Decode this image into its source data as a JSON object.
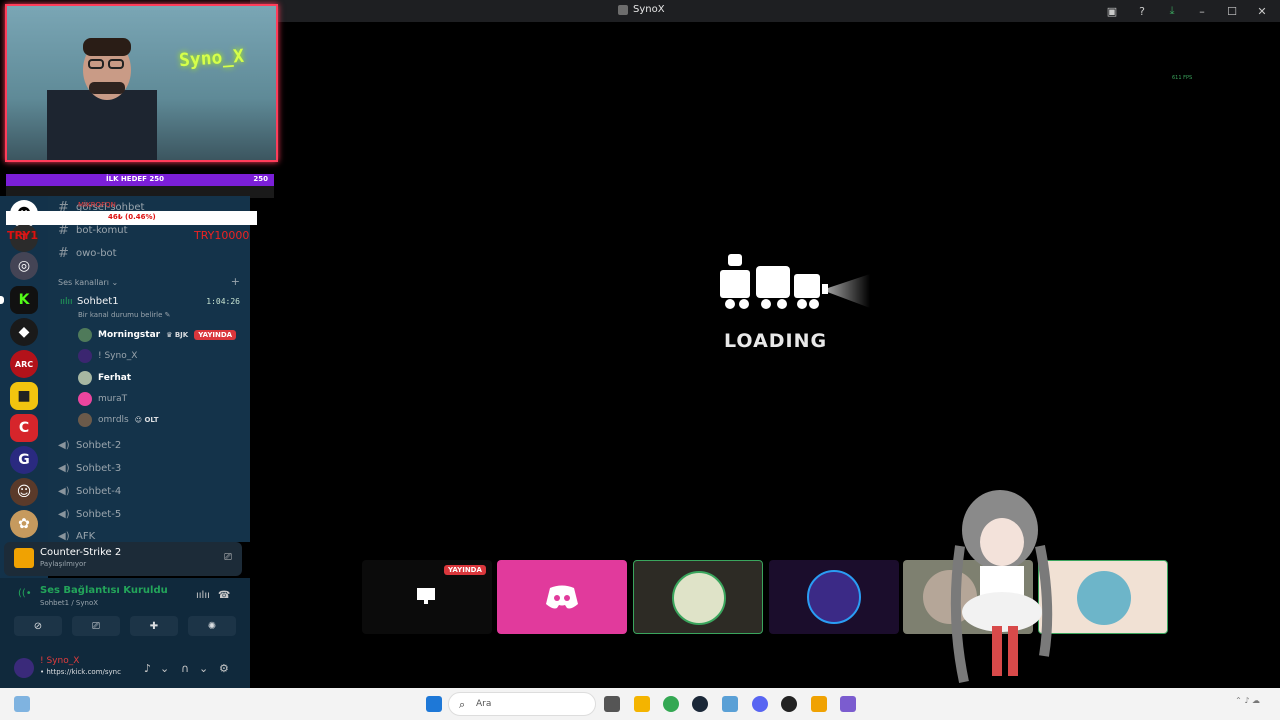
{
  "window": {
    "title": "SynoX"
  },
  "webcam": {
    "neon_text": "Syno_X"
  },
  "goal": {
    "label": "İLK HEDEF 250",
    "value": "250"
  },
  "overlay": {
    "mic_text": "MİKROFON",
    "percent": "46₺ (0.46%)",
    "try_left": "TRY1",
    "try_right": "TRY10000"
  },
  "channels": {
    "text": [
      "görsel-sohbet",
      "bot-komut",
      "owo-bot"
    ],
    "category": "Ses kanalları",
    "active_voice": {
      "name": "Sohbet1",
      "time": "1:04:26",
      "status": "Bir kanal durumu belirle"
    },
    "members": [
      {
        "name": "Morningstar",
        "tag": "BJK",
        "live": "YAYINDA"
      },
      {
        "name": "! Syno_X"
      },
      {
        "name": "Ferhat"
      },
      {
        "name": "muraT"
      },
      {
        "name": "omrdls",
        "tag": "OLT"
      }
    ],
    "voice": [
      "Sohbet-2",
      "Sohbet-3",
      "Sohbet-4",
      "Sohbet-5",
      "AFK"
    ]
  },
  "activity": {
    "game": "Counter-Strike 2",
    "status": "Paylaşılmıyor"
  },
  "voice_panel": {
    "state": "Ses Bağlantısı Kuruldu",
    "channel": "Sohbet1 / SynoX"
  },
  "user": {
    "name": "! Syno_X",
    "status": "• https://kick.com/sync"
  },
  "stage": {
    "loading": "LOADING",
    "fps": "611 FPS"
  },
  "tiles": {
    "live": "YAYINDA"
  },
  "taskbar": {
    "search_placeholder": "Ara"
  },
  "colors": {
    "accent": "#5865f2",
    "live_red": "#da373c",
    "connected_green": "#23a55a",
    "discord_pink": "#e13a9c"
  }
}
